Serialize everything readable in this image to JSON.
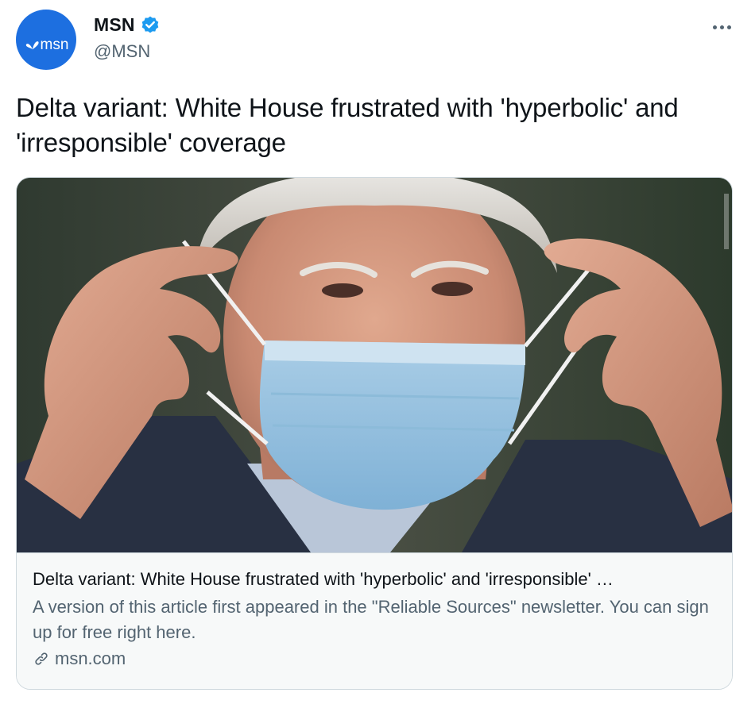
{
  "author": {
    "display_name": "MSN",
    "handle": "@MSN",
    "avatar_text": "msn",
    "verified": true,
    "verified_color": "#1d9bf0",
    "avatar_color": "#1d6fe0"
  },
  "tweet": {
    "text": "Delta variant: White House frustrated with 'hyperbolic' and 'irresponsible' coverage"
  },
  "card": {
    "image_icon": "photo-man-removing-face-mask",
    "title": "Delta variant: White House frustrated with 'hyperbolic' and 'irresponsible' …",
    "description": "A version of this article first appeared in the \"Reliable Sources\" newsletter. You can sign up for free right here.",
    "domain": "msn.com",
    "domain_icon": "link-icon"
  },
  "icons": {
    "more": "more-dots-icon",
    "verified": "verified-badge-icon"
  },
  "colors": {
    "text_primary": "#0f1419",
    "text_secondary": "#536471",
    "border": "#cfd9de",
    "card_background": "#f7f9f9"
  }
}
